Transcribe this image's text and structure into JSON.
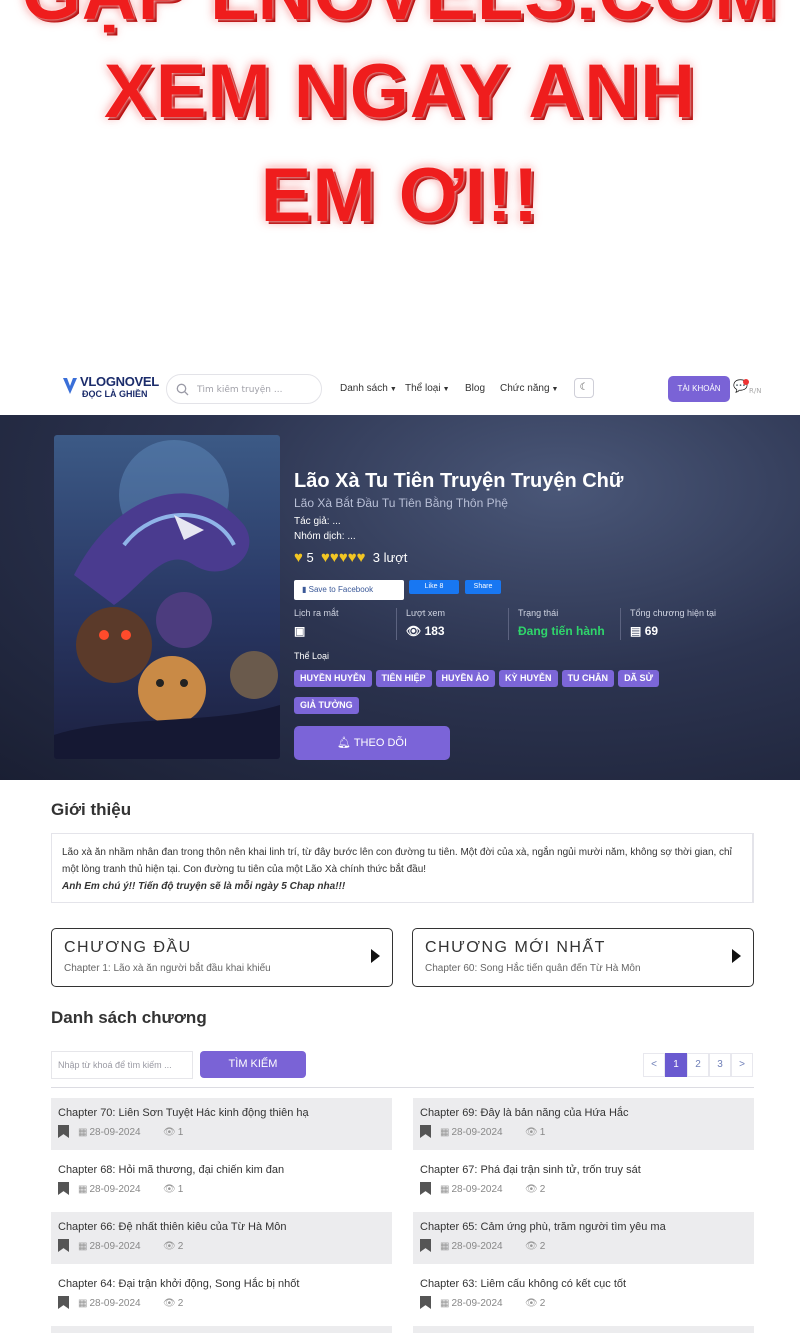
{
  "promo": {
    "line0": "GẶP LNOVELS.COM",
    "line1": "XEM NGAY ANH",
    "line2": "EM ƠI!!"
  },
  "nav": {
    "logo_top": "VLOGNOVEL",
    "logo_bottom": "ĐỌC LÀ GHIỀN",
    "search_placeholder": "Tìm kiếm truyện ...",
    "menu": [
      "Danh sách",
      "Thể loại",
      "Blog",
      "Chức năng"
    ],
    "account_button": "TÀI KHOẢN",
    "bell_label": "R/N"
  },
  "novel": {
    "title": "Lão Xà Tu Tiên Truyện Truyện Chữ",
    "alt_title": "Lão Xà Bắt Đầu Tu Tiên Bằng Thôn Phệ",
    "author_label": "Tác giả: ...",
    "group_label": "Nhóm dịch: ...",
    "rating_score": "5",
    "rating_hearts": 5,
    "rating_count": "3 lượt",
    "fb_save": "Save to Facebook",
    "fb_like": "Like 8",
    "fb_share": "Share",
    "stats": [
      {
        "label": "Lịch ra mắt",
        "value": ""
      },
      {
        "label": "Lượt xem",
        "value": "183"
      },
      {
        "label": "Trạng thái",
        "value": "Đang tiến hành"
      },
      {
        "label": "Tổng chương hiện tại",
        "value": "69"
      }
    ],
    "genres_label": "Thể Loại",
    "genres": [
      "HUYỀN HUYỄN",
      "TIÊN HIỆP",
      "HUYỀN ẢO",
      "KỲ HUYỄN",
      "TU CHÂN",
      "DÃ SỬ",
      "GIẢ TƯỞNG"
    ],
    "follow_button": "THEO DÕI"
  },
  "intro": {
    "heading": "Giới thiệu",
    "text": "Lão xà ăn nhầm nhân đan trong thôn nên khai linh trí, từ đây bước lên con đường tu tiên. Một đời của xà, ngắn ngủi mười năm, không sợ thời gian, chỉ một lòng tranh thủ hiện tại. Con đường tu tiên của một Lão Xà chính thức bắt đầu!",
    "note": "Anh Em chú ý!! Tiến độ truyện sẽ là mỗi ngày 5 Chap nha!!!"
  },
  "first_chapter": {
    "title": "CHƯƠNG ĐẦU",
    "subtitle": "Chapter 1: Lão xà ăn người bắt đầu khai khiếu"
  },
  "latest_chapter": {
    "title": "CHƯƠNG MỚI NHẤT",
    "subtitle": "Chapter 60: Song Hắc tiến quân đến Từ Hà Môn"
  },
  "chapter_list": {
    "heading": "Danh sách chương",
    "keyword_placeholder": "Nhập từ khoá để tìm kiếm ...",
    "search_button": "TÌM KIẾM",
    "pagination": [
      "<",
      "1",
      "2",
      "3",
      ">"
    ],
    "active_page": "1",
    "chapters": [
      {
        "name": "Chapter 70: Liên Sơn Tuyệt Hác kinh động thiên hạ",
        "date": "28-09-2024",
        "views": "1"
      },
      {
        "name": "Chapter 69: Đây là bản năng của Hứa Hắc",
        "date": "28-09-2024",
        "views": "1"
      },
      {
        "name": "Chapter 68: Hỏi mã thương, đại chiến kim đan",
        "date": "28-09-2024",
        "views": "1"
      },
      {
        "name": "Chapter 67: Phá đại trận sinh tử, trốn truy sát",
        "date": "28-09-2024",
        "views": "2"
      },
      {
        "name": "Chapter 66: Đệ nhất thiên kiêu của Từ Hà Môn",
        "date": "28-09-2024",
        "views": "2"
      },
      {
        "name": "Chapter 65: Cảm ứng phù, trăm người tìm yêu ma",
        "date": "28-09-2024",
        "views": "2"
      },
      {
        "name": "Chapter 64: Đại trận khởi động, Song Hắc bị nhốt",
        "date": "28-09-2024",
        "views": "2"
      },
      {
        "name": "Chapter 63: Liêm cấu không có kết cục tốt",
        "date": "28-09-2024",
        "views": "2"
      }
    ]
  },
  "icons": [
    "search-icon",
    "moon-icon",
    "bell-icon",
    "heart-icon",
    "facebook-bookmark-icon",
    "calendar-icon",
    "eye-icon",
    "book-icon",
    "bookmark-icon",
    "bell-follow-icon",
    "triangle-right-icon"
  ],
  "colors": {
    "accent": "#7a63d6",
    "status_green": "#2fd56b",
    "promo_red": "#ef1d1d",
    "star_yellow": "#f2c623"
  }
}
